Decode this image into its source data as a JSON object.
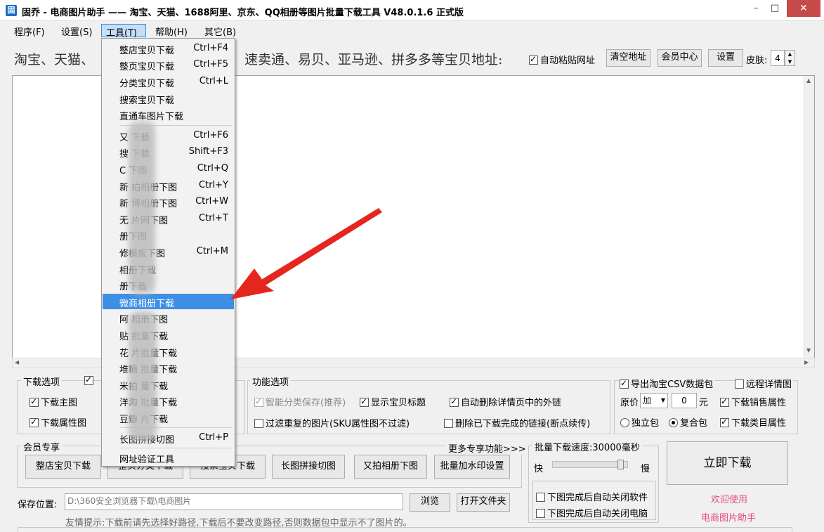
{
  "window": {
    "title": "固乔 - 电商图片助手 —— 淘宝、天猫、1688阿里、京东、QQ相册等图片批量下载工具 V48.0.1.6 正式版",
    "icon": "app-icon",
    "minimize": "–",
    "maximize": "□",
    "close": "×"
  },
  "menubar": {
    "items": [
      "程序(F)",
      "设置(S)",
      "工具(T)",
      "帮助(H)",
      "其它(B)"
    ]
  },
  "url_row": {
    "left_text": "淘宝、天猫、",
    "right_text": "速卖通、易贝、亚马逊、拼多多等宝贝地址:",
    "auto_paste": "自动粘贴网址",
    "clear": "清空地址",
    "member": "会员中心",
    "settings": "设置",
    "skin_label": "皮肤:",
    "skin_value": "4"
  },
  "dropdown": {
    "items": [
      {
        "label": "整店宝贝下载",
        "key": "Ctrl+F4"
      },
      {
        "label": "整页宝贝下载",
        "key": "Ctrl+F5"
      },
      {
        "label": "分类宝贝下载",
        "key": "Ctrl+L"
      },
      {
        "label": "搜索宝贝下载",
        "key": ""
      },
      {
        "label": "直通车图片下载",
        "key": ""
      },
      {
        "label": "又  下载",
        "key": "Ctrl+F6"
      },
      {
        "label": "搜  下载",
        "key": "Shift+F3"
      },
      {
        "label": "C  下图",
        "key": "Ctrl+Q"
      },
      {
        "label": "新  拍相册下图",
        "key": "Ctrl+Y"
      },
      {
        "label": "新  博相册下图",
        "key": "Ctrl+W"
      },
      {
        "label": "无  片网下图",
        "key": "Ctrl+T"
      },
      {
        "label": "  册下图",
        "key": ""
      },
      {
        "label": "  修模板下图",
        "key": "Ctrl+M"
      },
      {
        "label": "  相册下载",
        "key": ""
      },
      {
        "label": "  册下载",
        "key": ""
      },
      {
        "label": "微商相册下载",
        "key": ""
      },
      {
        "label": "阿  相册下图",
        "key": ""
      },
      {
        "label": "贴  批量下载",
        "key": ""
      },
      {
        "label": "花  片批量下载",
        "key": ""
      },
      {
        "label": "堆糖  批量下载",
        "key": ""
      },
      {
        "label": "米拍  量下载",
        "key": ""
      },
      {
        "label": "洋淘  批量下载",
        "key": ""
      },
      {
        "label": "豆瓣  片下载",
        "key": ""
      },
      {
        "label": "长图拼接切图",
        "key": "Ctrl+P"
      },
      {
        "label": "网址验证工具",
        "key": ""
      }
    ]
  },
  "download_options": {
    "title": "下载选项",
    "main_image": "下载主图",
    "attr_image": "下载属性图"
  },
  "function_options": {
    "title": "功能选项",
    "smart_category": "智能分类保存(推荐)",
    "show_title": "显示宝贝标题",
    "auto_delete_links": "自动删除详情页中的外链",
    "filter_dup": "过滤重复的图片(SKU属性图不过滤)",
    "delete_done": "删除已下载完成的链接(断点续传)"
  },
  "csv_options": {
    "export_csv": "导出淘宝CSV数据包",
    "remote_detail": "远程详情图",
    "price_label": "原价",
    "price_op": "加",
    "price_value": "0",
    "price_unit": "元",
    "sales_attr": "下载销售属性",
    "independent": "独立包",
    "composite": "复合包",
    "category_attr": "下载类目属性"
  },
  "member": {
    "title": "会员专享",
    "more": "更多专享功能>>>",
    "buttons": [
      "整店宝贝下载",
      "整页分类下载",
      "搜索宝贝下载",
      "长图拼接切图",
      "又拍相册下图",
      "批量加水印设置"
    ]
  },
  "speed": {
    "title": "批量下载速度:30000毫秒",
    "fast": "快",
    "slow": "慢",
    "slider_fraction": 0.95,
    "close_app": "下图完成后自动关闭软件",
    "shutdown": "下图完成后自动关闭电脑"
  },
  "download_now": "立即下载",
  "welcome": [
    "欢迎使用",
    "电商图片助手"
  ],
  "save": {
    "label": "保存位置:",
    "path": "D:\\360安全浏览器下载\\电商图片",
    "browse": "浏览",
    "open_folder": "打开文件夹",
    "tip": "友情提示:下载前请先选择好路径,下载后不要改变路径,否则数据包中显示不了图片的。"
  },
  "colors": {
    "highlight": "#3d8ee5",
    "arrow": "#e5261f",
    "pink": "#e54b7a"
  }
}
